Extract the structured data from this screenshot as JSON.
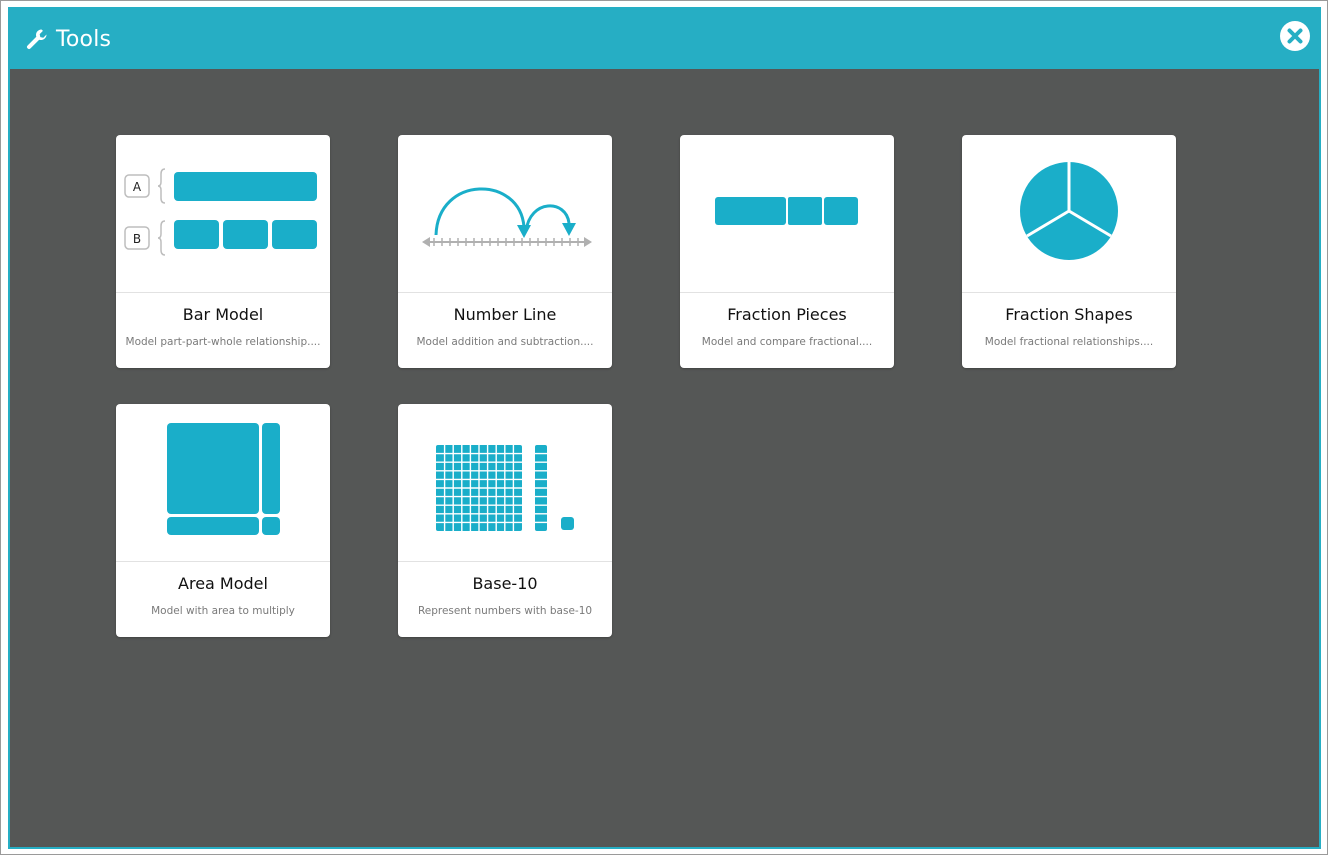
{
  "header": {
    "title": "Tools",
    "title_icon": "wrench-icon",
    "close_icon": "close-icon"
  },
  "colors": {
    "accent": "#26aec4",
    "tool_blue": "#1aaec9",
    "background": "#555756",
    "card": "#ffffff"
  },
  "tools": [
    {
      "name": "Bar Model",
      "description": "Model part-part-whole relationship....",
      "icon": "bar-model-icon",
      "labels": [
        "A",
        "B"
      ]
    },
    {
      "name": "Number Line",
      "description": "Model addition and subtraction....",
      "icon": "number-line-icon"
    },
    {
      "name": "Fraction Pieces",
      "description": "Model and compare fractional....",
      "icon": "fraction-pieces-icon"
    },
    {
      "name": "Fraction Shapes",
      "description": "Model fractional relationships....",
      "icon": "fraction-shapes-icon"
    },
    {
      "name": "Area Model",
      "description": "Model with area to multiply",
      "icon": "area-model-icon"
    },
    {
      "name": "Base-10",
      "description": "Represent numbers with base-10",
      "icon": "base-10-icon"
    }
  ]
}
